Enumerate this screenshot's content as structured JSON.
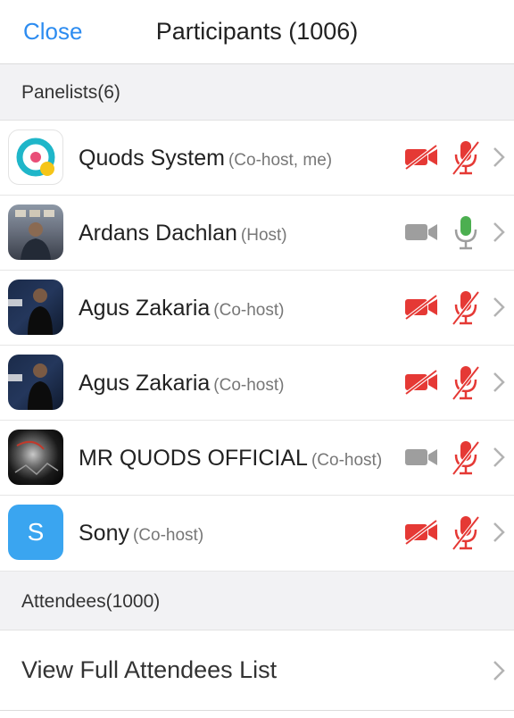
{
  "header": {
    "close_label": "Close",
    "title": "Participants (1006)"
  },
  "panelists": {
    "section_label": "Panelists(6)",
    "items": [
      {
        "name": "Quods System",
        "role": "(Co-host, me)",
        "video": "off",
        "audio": "muted",
        "avatar": "app-logo"
      },
      {
        "name": "Ardans Dachlan",
        "role": "(Host)",
        "video": "on",
        "audio": "active",
        "avatar": "photo"
      },
      {
        "name": "Agus Zakaria",
        "role": "(Co-host)",
        "video": "off",
        "audio": "muted",
        "avatar": "photo"
      },
      {
        "name": "Agus Zakaria",
        "role": "(Co-host)",
        "video": "off",
        "audio": "muted",
        "avatar": "photo"
      },
      {
        "name": "MR QUODS OFFICIAL",
        "role": "(Co-host)",
        "video": "on",
        "audio": "muted",
        "avatar": "photo"
      },
      {
        "name": "Sony",
        "role": "(Co-host)",
        "video": "off",
        "audio": "muted",
        "avatar_letter": "S"
      }
    ]
  },
  "attendees": {
    "section_label": "Attendees(1000)",
    "view_full_label": "View Full Attendees List"
  },
  "colors": {
    "accent": "#2d8cf0",
    "muted_red": "#e53935",
    "active_green": "#4caf50",
    "icon_gray": "#9e9e9e",
    "section_bg": "#f2f2f4"
  }
}
